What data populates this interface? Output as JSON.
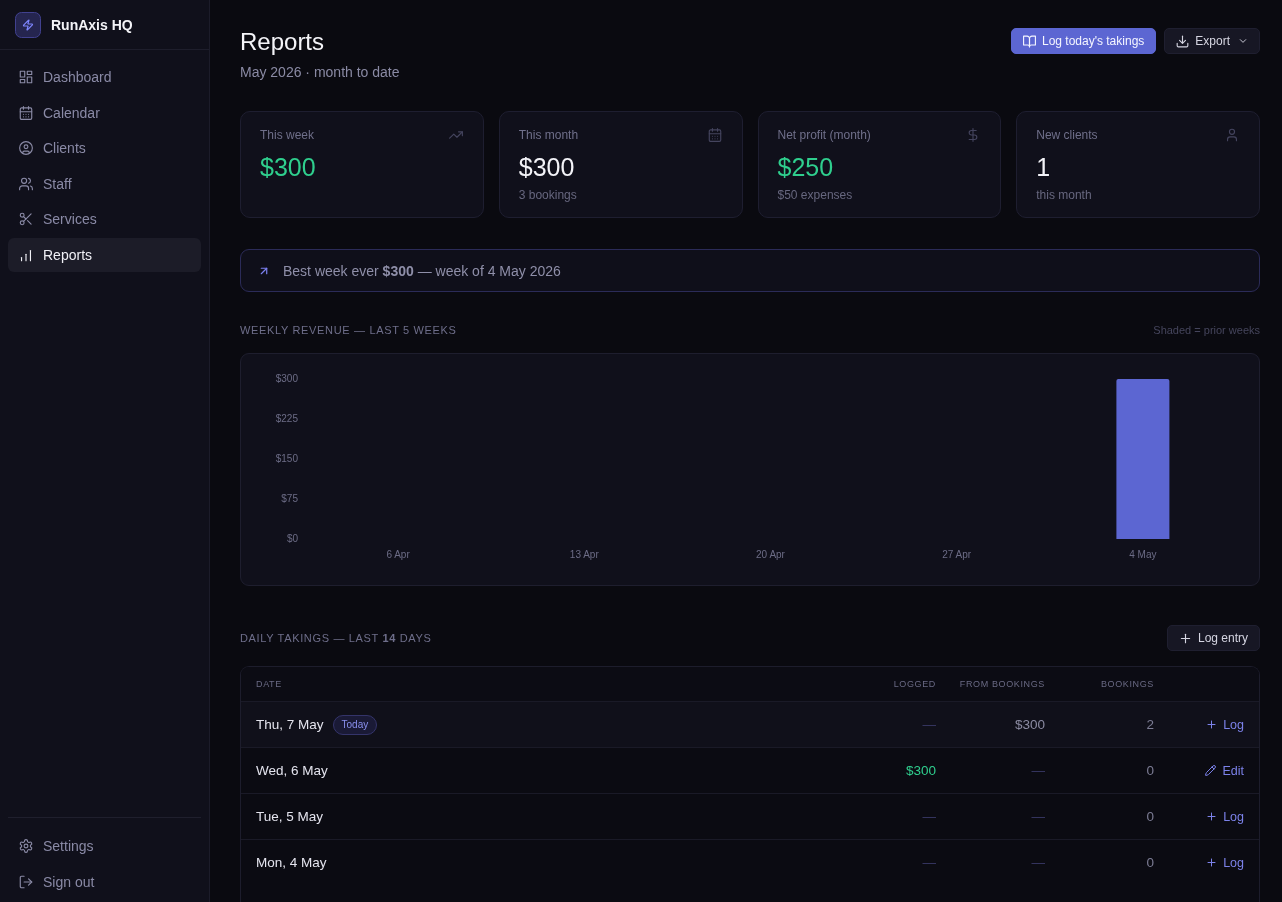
{
  "sidebar": {
    "brand": {
      "name": "RunAxis HQ"
    },
    "nav": [
      {
        "label": "Dashboard",
        "selected": false
      },
      {
        "label": "Calendar",
        "selected": false
      },
      {
        "label": "Clients",
        "selected": false
      },
      {
        "label": "Staff",
        "selected": false
      },
      {
        "label": "Services",
        "selected": false
      },
      {
        "label": "Reports",
        "selected": true
      }
    ],
    "footer": [
      {
        "label": "Settings"
      },
      {
        "label": "Sign out"
      }
    ]
  },
  "header": {
    "title": "Reports",
    "subtitle": "May 2026 · month to date",
    "actions": [
      {
        "label": "Log today's takings",
        "kind": "primary"
      },
      {
        "label": "Export",
        "kind": "menu"
      }
    ]
  },
  "stats": [
    {
      "label": "This week",
      "value": "$300",
      "color": "#2fcf8e"
    },
    {
      "label": "This month",
      "value": "$300",
      "sub": "3 bookings",
      "color": "#f3f3f8"
    },
    {
      "label": "Net profit (month)",
      "value": "$250",
      "sub": "$50 expenses",
      "color": "#2fcf8e"
    },
    {
      "label": "New clients",
      "value": "1",
      "sub": "this month",
      "color": "#f3f3f8"
    }
  ],
  "highlight": {
    "text": "Best week ever **$300** — week of 4 May 2026"
  },
  "weekly_revenue": {
    "title": "WEEKLY REVENUE — LAST 5 WEEKS",
    "legend": "Shaded = prior weeks",
    "chart_data": {
      "type": "bar",
      "categories": [
        "6 Apr",
        "13 Apr",
        "20 Apr",
        "27 Apr",
        "4 May"
      ],
      "values": [
        0,
        0,
        0,
        0,
        300
      ],
      "ylim": [
        0,
        300
      ],
      "yticks": [
        {
          "value": 0,
          "label": "$0"
        },
        {
          "value": 75,
          "label": "$75"
        },
        {
          "value": 150,
          "label": "$150"
        },
        {
          "value": 225,
          "label": "$225"
        },
        {
          "value": 300,
          "label": "$300"
        }
      ]
    }
  },
  "daily_takings": {
    "title": "DAILY TAKINGS — LAST **14** DAYS",
    "button": "Log entry",
    "columns": [
      {
        "label": "DATE"
      },
      {
        "label": "LOGGED"
      },
      {
        "label": "FROM BOOKINGS"
      },
      {
        "label": "BOOKINGS"
      }
    ],
    "rows": [
      {
        "date": "Thu, 7 May",
        "badge": "Today",
        "logged": {
          "text": "—",
          "filled": false
        },
        "from_bookings": {
          "text": "$300",
          "filled": true
        },
        "bookings": "2",
        "action": {
          "kind": "add",
          "label": "Log"
        }
      },
      {
        "date": "Wed, 6 May",
        "logged": {
          "text": "$300",
          "filled": true
        },
        "from_bookings": {
          "text": "—",
          "filled": false
        },
        "bookings": "0",
        "action": {
          "kind": "edit",
          "label": "Edit"
        }
      },
      {
        "date": "Tue, 5 May",
        "logged": {
          "text": "—",
          "filled": false
        },
        "from_bookings": {
          "text": "—",
          "filled": false
        },
        "bookings": "0",
        "action": {
          "kind": "add",
          "label": "Log"
        }
      },
      {
        "date": "Mon, 4 May",
        "logged": {
          "text": "—",
          "filled": false
        },
        "from_bookings": {
          "text": "—",
          "filled": false
        },
        "bookings": "0",
        "action": {
          "kind": "add",
          "label": "Log"
        }
      }
    ]
  }
}
